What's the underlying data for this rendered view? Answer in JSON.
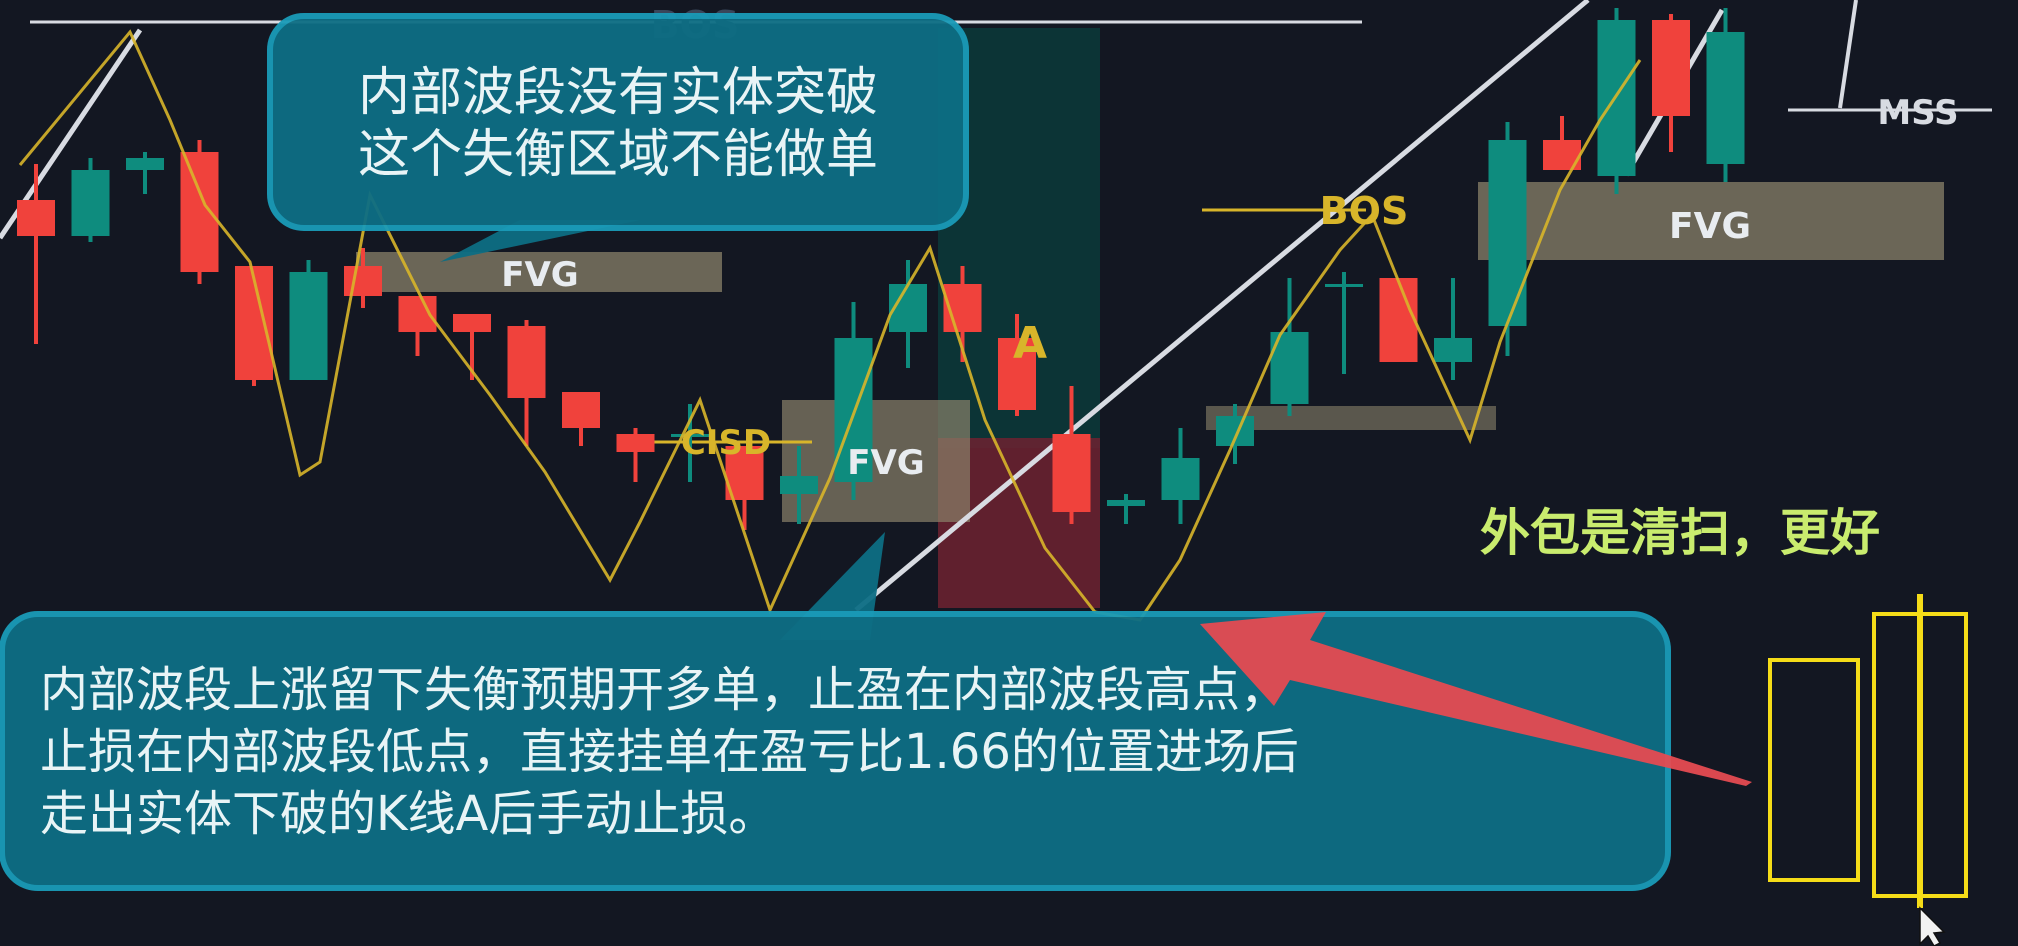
{
  "chart_data": {
    "type": "candlestick",
    "series": [
      {
        "o": 64,
        "h": 76,
        "l": 46,
        "c": 70,
        "dir": "down"
      },
      {
        "o": 64,
        "h": 77,
        "l": 63,
        "c": 75,
        "dir": "up"
      },
      {
        "o": 75,
        "h": 78,
        "l": 71,
        "c": 77,
        "dir": "up"
      },
      {
        "o": 78,
        "h": 80,
        "l": 56,
        "c": 58,
        "dir": "down"
      },
      {
        "o": 59,
        "h": 59,
        "l": 39,
        "c": 40,
        "dir": "down"
      },
      {
        "o": 40,
        "h": 60,
        "l": 40,
        "c": 58,
        "dir": "up"
      },
      {
        "o": 59,
        "h": 62,
        "l": 52,
        "c": 54,
        "dir": "down"
      },
      {
        "o": 54,
        "h": 54,
        "l": 44,
        "c": 48,
        "dir": "down"
      },
      {
        "o": 51,
        "h": 51,
        "l": 40,
        "c": 48,
        "dir": "down"
      },
      {
        "o": 49,
        "h": 50,
        "l": 29,
        "c": 37,
        "dir": "down"
      },
      {
        "o": 38,
        "h": 38,
        "l": 29,
        "c": 32,
        "dir": "down"
      },
      {
        "o": 31,
        "h": 32,
        "l": 23,
        "c": 28,
        "dir": "down"
      },
      {
        "o": 31,
        "h": 36,
        "l": 23,
        "c": 31,
        "dir": "up"
      },
      {
        "o": 29,
        "h": 29,
        "l": 15,
        "c": 20,
        "dir": "down"
      },
      {
        "o": 21,
        "h": 29,
        "l": 16,
        "c": 24,
        "dir": "up"
      },
      {
        "o": 23,
        "h": 53,
        "l": 20,
        "c": 47,
        "dir": "up"
      },
      {
        "o": 48,
        "h": 60,
        "l": 42,
        "c": 56,
        "dir": "up"
      },
      {
        "o": 56,
        "h": 59,
        "l": 43,
        "c": 48,
        "dir": "down"
      },
      {
        "o": 47,
        "h": 51,
        "l": 34,
        "c": 35,
        "dir": "down"
      },
      {
        "o": 31,
        "h": 39,
        "l": 16,
        "c": 18,
        "dir": "down"
      },
      {
        "o": 19,
        "h": 21,
        "l": 16,
        "c": 20,
        "dir": "up"
      },
      {
        "o": 20,
        "h": 32,
        "l": 16,
        "c": 27,
        "dir": "up"
      },
      {
        "o": 29,
        "h": 36,
        "l": 26,
        "c": 34,
        "dir": "up"
      },
      {
        "o": 36,
        "h": 57,
        "l": 34,
        "c": 48,
        "dir": "up"
      },
      {
        "o": 56,
        "h": 58,
        "l": 41,
        "c": 56,
        "dir": "up"
      },
      {
        "o": 57,
        "h": 57,
        "l": 43,
        "c": 43,
        "dir": "down"
      },
      {
        "o": 43,
        "h": 57,
        "l": 40,
        "c": 47,
        "dir": "up"
      },
      {
        "o": 49,
        "h": 83,
        "l": 44,
        "c": 80,
        "dir": "up"
      },
      {
        "o": 80,
        "h": 84,
        "l": 75,
        "c": 75,
        "dir": "down"
      },
      {
        "o": 74,
        "h": 102,
        "l": 71,
        "c": 100,
        "dir": "up"
      },
      {
        "o": 100,
        "h": 101,
        "l": 78,
        "c": 84,
        "dir": "down"
      },
      {
        "o": 76,
        "h": 102,
        "l": 73,
        "c": 98,
        "dir": "up"
      }
    ],
    "ylim": [
      0,
      100
    ],
    "annotations": {
      "bos_top": "BOS",
      "bos_right": "BOS",
      "mss": "MSS",
      "fvg_1": "FVG",
      "fvg_2": "FVG",
      "fvg_3": "FVG",
      "cisd": "CISD",
      "candle_a": "A"
    }
  },
  "callout_top": {
    "line1": "内部波段没有实体突破",
    "line2": "这个失衡区域不能做单"
  },
  "callout_bottom": {
    "line1": "内部波段上涨留下失衡预期开多单，止盈在内部波段高点，",
    "line2": "止损在内部波段低点，直接挂单在盈亏比1.66的位置进场后",
    "line3": "走出实体下破的K线A后手动止损。"
  },
  "side_note": "外包是清扫，更好",
  "colors": {
    "background": "#131722",
    "bull": "#0e8c7e",
    "bear": "#f0423c",
    "zigzag": "#d8b52a",
    "fvg": "#8a826a",
    "callout_bg": "#0d6e84",
    "callout_border": "#1a9bb8",
    "arrow": "#e54b52",
    "note": "#c9ec6e",
    "outline": "#f5dc18"
  }
}
